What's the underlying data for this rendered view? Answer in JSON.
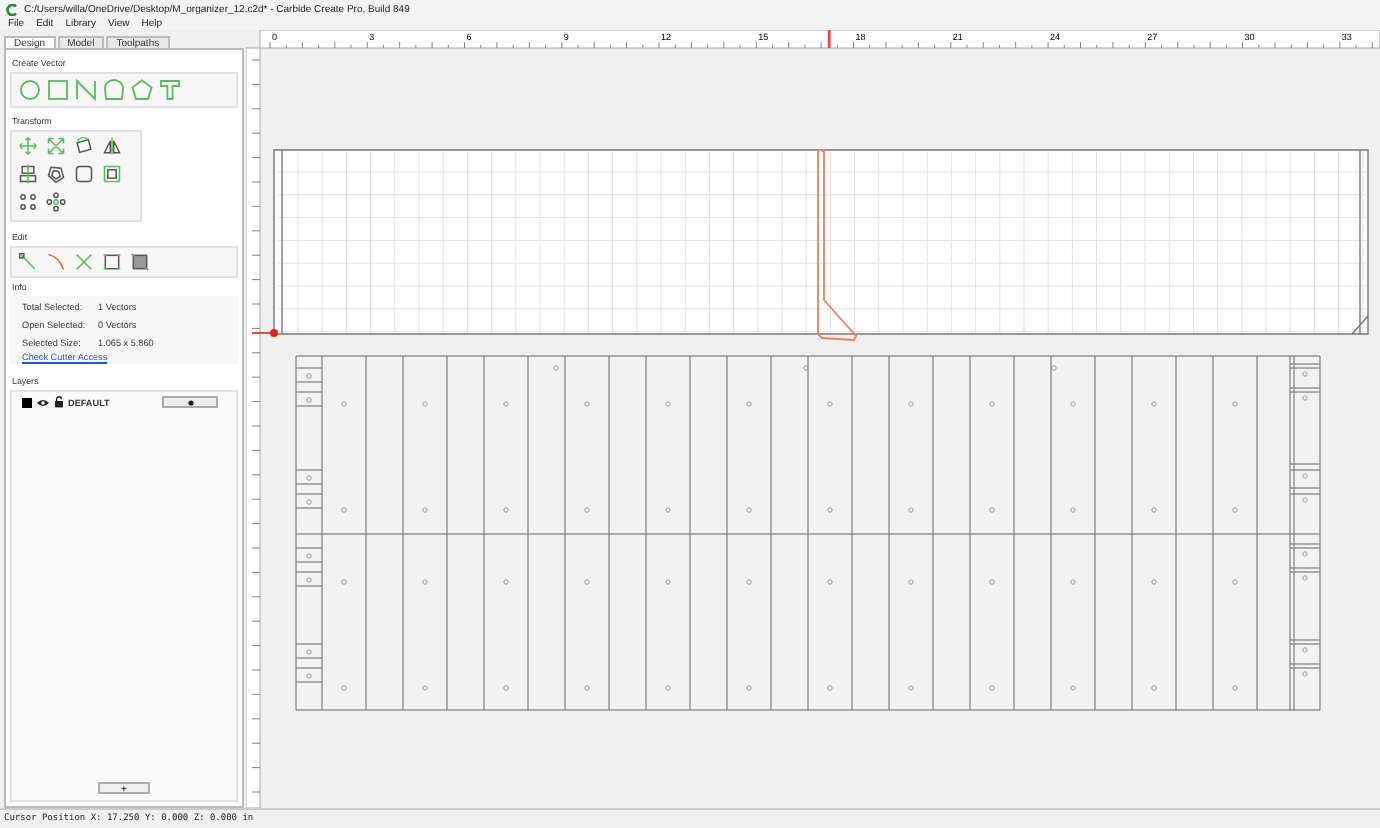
{
  "window": {
    "title": "C:/Users/willa/OneDrive/Desktop/M_organizer_12.c2d* - Carbide Create Pro, Build 849"
  },
  "menu": [
    "File",
    "Edit",
    "Library",
    "View",
    "Help"
  ],
  "tabs": [
    {
      "label": "Design",
      "selected": true
    },
    {
      "label": "Model",
      "selected": false
    },
    {
      "label": "Toolpaths",
      "selected": false
    }
  ],
  "sections": {
    "create_vector": "Create Vector",
    "transform": "Transform",
    "edit": "Edit"
  },
  "info": {
    "label": "Info",
    "rows": [
      {
        "label": "Total Selected:",
        "value": "1 Vectors"
      },
      {
        "label": "Open Selected:",
        "value": "0 Vectors"
      },
      {
        "label": "Selected Size:",
        "value": "1.065 x 5.860"
      }
    ],
    "link": "Check Cutter Access"
  },
  "layers": {
    "label": "Layers",
    "items": [
      {
        "name": "DEFAULT",
        "color": "#000000",
        "visible": true
      }
    ],
    "add_button": "+"
  },
  "ruler": {
    "labels": [
      "0",
      "3",
      "6",
      "9",
      "12",
      "15",
      "18",
      "21",
      "24",
      "27",
      "30",
      "33"
    ]
  },
  "status_bar": "Cursor Position X: 17.250 Y: 0.000 Z: 0.000 in"
}
